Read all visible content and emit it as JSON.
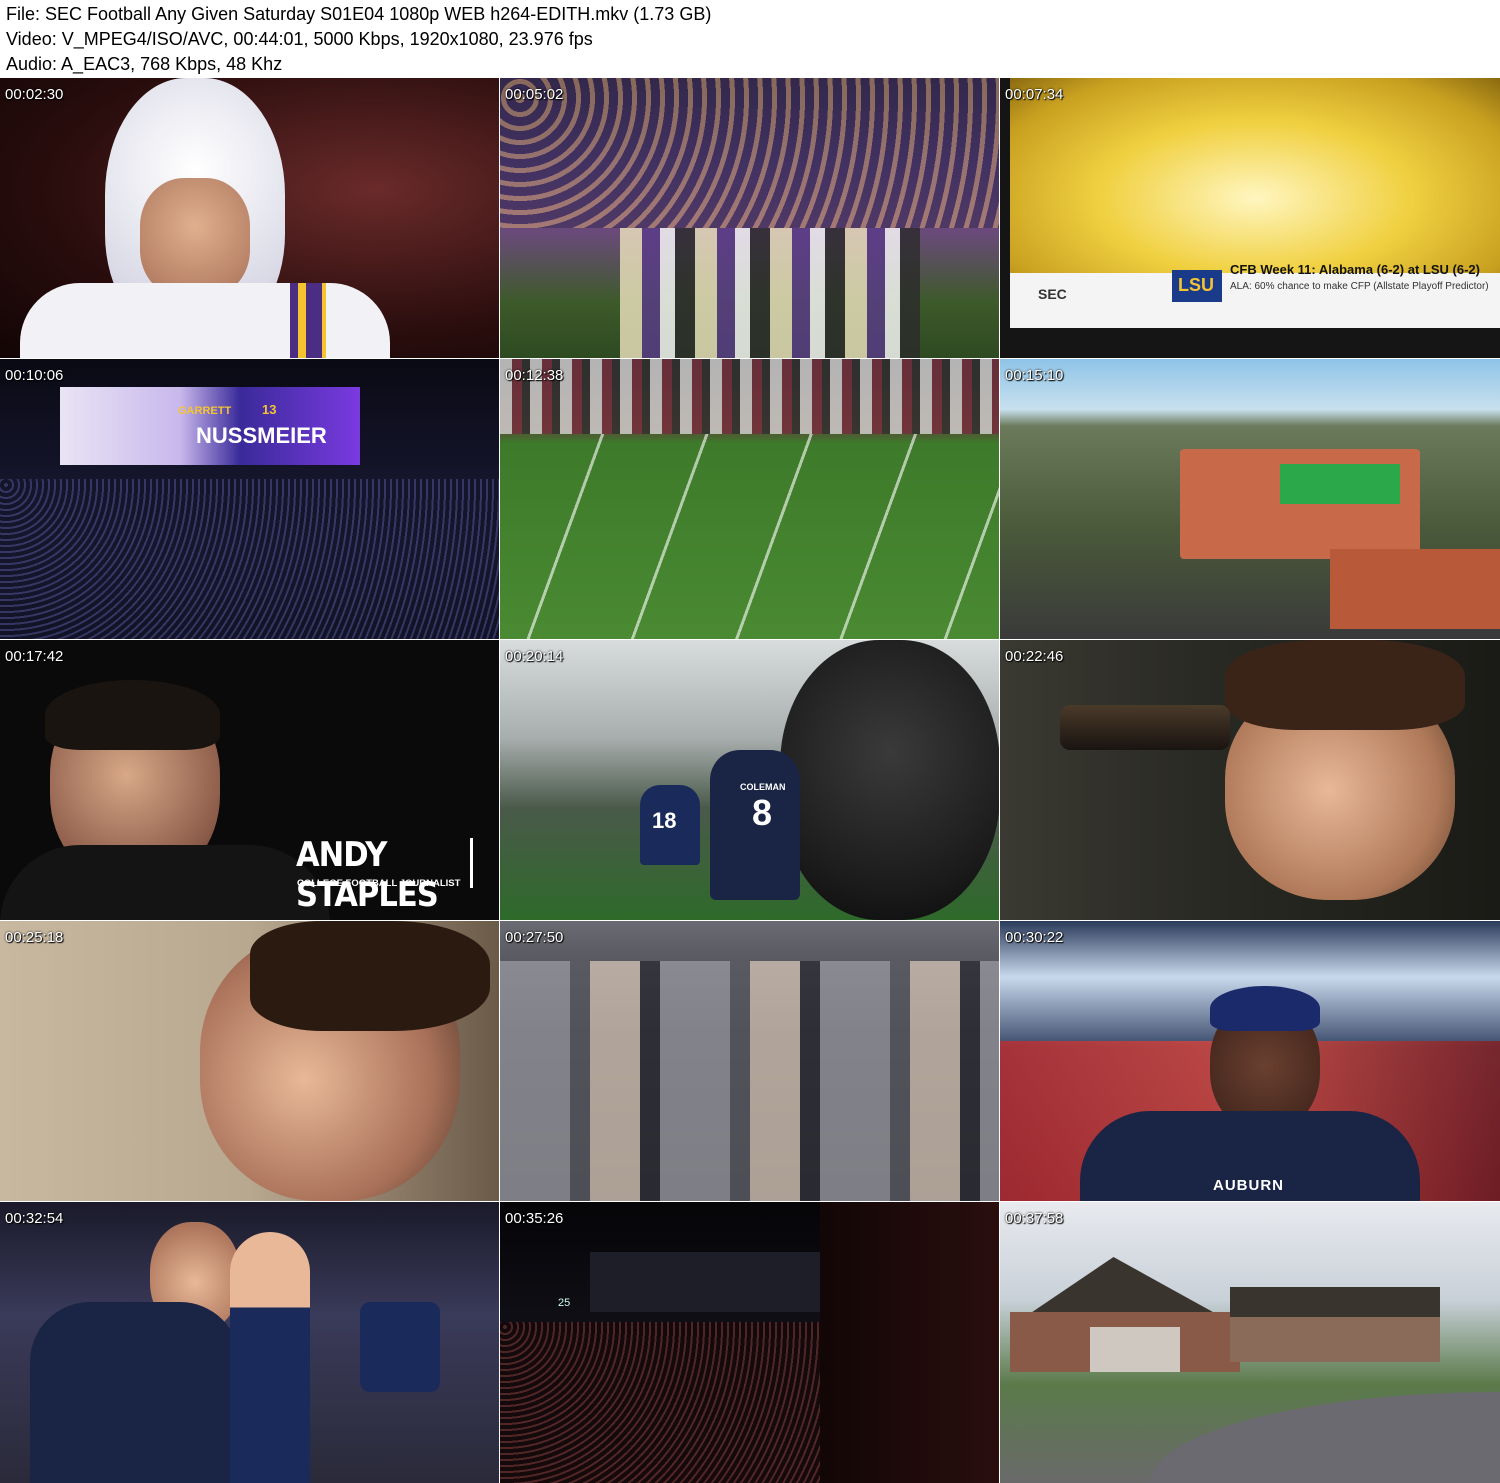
{
  "header": {
    "file_line": "File: SEC Football Any Given Saturday S01E04 1080p WEB h264-EDITH.mkv (1.73 GB)",
    "video_line": "Video: V_MPEG4/ISO/AVC, 00:44:01, 5000 Kbps, 1920x1080, 23.976 fps",
    "audio_line": "Audio: A_EAC3, 768 Kbps, 48 Khz"
  },
  "thumbnails": [
    {
      "timestamp": "00:02:30"
    },
    {
      "timestamp": "00:05:02"
    },
    {
      "timestamp": "00:07:34",
      "banner_title": "CFB Week 11: Alabama (6-2) at LSU (6-2)",
      "banner_sub": "ALA: 60% chance to make CFP (Allstate Playoff Predictor)",
      "network": "SEC",
      "team_abbr": "LSU"
    },
    {
      "timestamp": "00:10:06",
      "board_first": "GARRETT",
      "board_number": "13",
      "board_last": "NUSSMEIER"
    },
    {
      "timestamp": "00:12:38"
    },
    {
      "timestamp": "00:15:10"
    },
    {
      "timestamp": "00:17:42",
      "name": "ANDY STAPLES",
      "title": "COLLEGE FOOTBALL JOURNALIST"
    },
    {
      "timestamp": "00:20:14",
      "jersey_name": "COLEMAN",
      "jersey_number": "8",
      "jersey_number_2": "18"
    },
    {
      "timestamp": "00:22:46"
    },
    {
      "timestamp": "00:25:18"
    },
    {
      "timestamp": "00:27:50"
    },
    {
      "timestamp": "00:30:22",
      "jersey_text": "AUBURN"
    },
    {
      "timestamp": "00:32:54"
    },
    {
      "timestamp": "00:35:26",
      "scoreboard": "25"
    },
    {
      "timestamp": "00:37:58"
    }
  ]
}
